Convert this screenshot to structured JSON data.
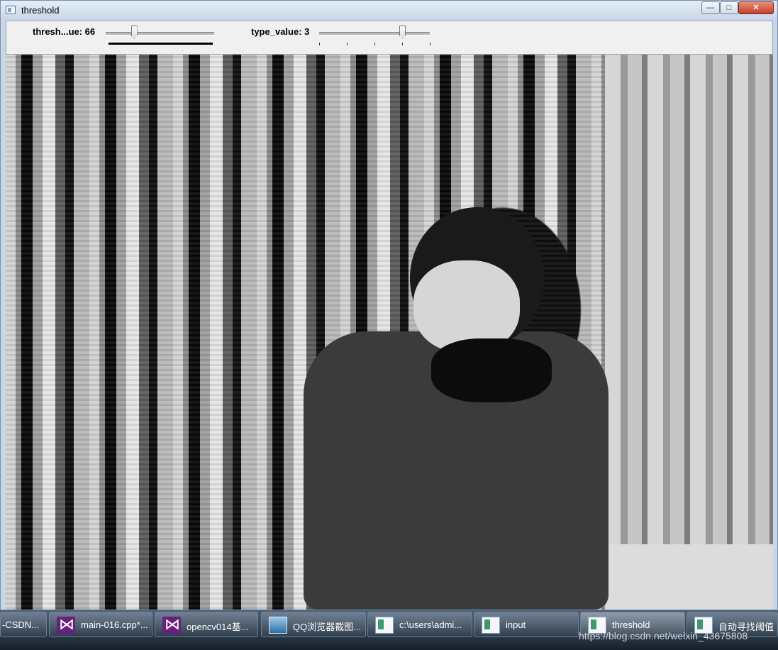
{
  "window": {
    "title": "threshold",
    "controls": {
      "minimize": "—",
      "maximize": "□",
      "close": "✕"
    }
  },
  "trackbars": [
    {
      "label": "thresh...ue: 66",
      "value": 66,
      "max": 255
    },
    {
      "label": "type_value: 3",
      "value": 3,
      "max": 4
    }
  ],
  "image": {
    "alt_semantic": "thresholded-photo"
  },
  "taskbar": {
    "items": [
      {
        "label": "-CSDN...",
        "icon": "browser-icon"
      },
      {
        "label": "main-016.cpp*...",
        "icon": "visual-studio-icon"
      },
      {
        "label": "opencv014基...",
        "icon": "visual-studio-icon"
      },
      {
        "label": "QQ浏览器截图...",
        "icon": "image-viewer-icon"
      },
      {
        "label": "c:\\users\\admi...",
        "icon": "window-icon"
      },
      {
        "label": "input",
        "icon": "window-icon"
      },
      {
        "label": "threshold",
        "icon": "window-icon"
      },
      {
        "label": "自动寻找阈值",
        "icon": "window-icon"
      }
    ],
    "watermark": "https://blog.csdn.net/weixin_43675808"
  }
}
